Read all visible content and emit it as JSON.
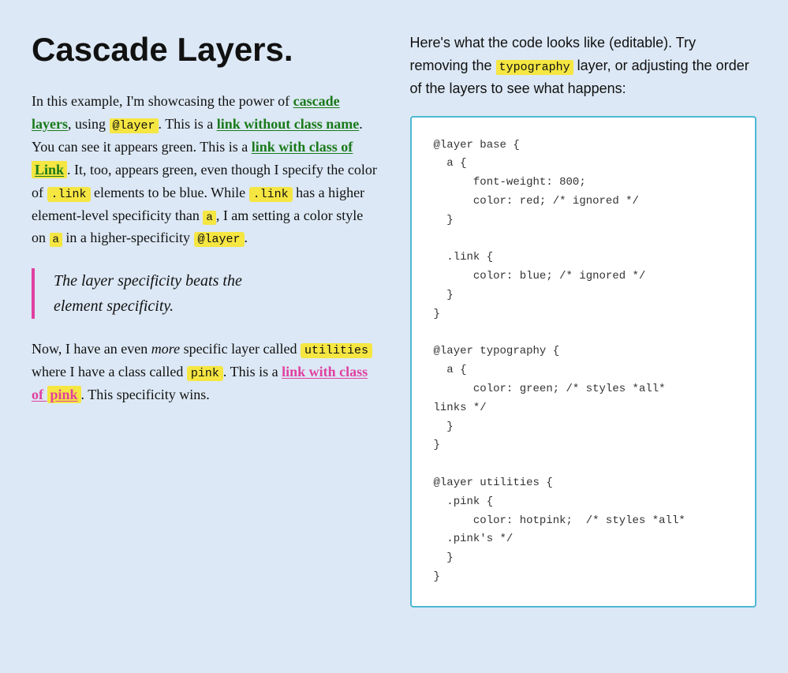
{
  "page": {
    "title": "Cascade Layers.",
    "left": {
      "intro": "In this example, I'm showcasing the power of",
      "cascade_layers_link": "cascade layers",
      "using_text": ", using",
      "at_layer_code": "@layer",
      "period_text": ". This is a",
      "link_without_class": "link without class name",
      "can_see_text": ". You can see it appears green. This is a",
      "link_with_class_of": "link with class of",
      "link_code": "link",
      "period2": ". It, too, appears green, even though I specify the color of",
      "dot_link_code": ".link",
      "elements_text": "elements to be blue. While",
      "dot_link_code2": ".link",
      "has_a_text": "has a higher element-level specificity than",
      "a_code": "a",
      "setting_text": ", I am setting a color style on",
      "a_code2": "a",
      "in_higher_text": "in a higher-specificity",
      "at_layer_code2": "@layer",
      "final_period": ".",
      "blockquote": {
        "line1": "The ",
        "layer_em": "layer",
        "line1_rest": " specificity beats the",
        "line2_em": "element specificity",
        "line2_rest": "."
      },
      "now_text": "Now, I have an even",
      "more_em": "more",
      "specific_text": "specific layer called",
      "utilities_code": "utilities",
      "where_text": "where I have a class called",
      "pink_code": "pink",
      "this_is_text": ". This is a",
      "link_with_class_of2": "link with class of",
      "pink_code2": "pink",
      "this_specificity": ". This specificity wins."
    },
    "right": {
      "intro_line1": "Here's what the code looks like (editable). Try",
      "intro_line2": "removing the",
      "typography_code": "typography",
      "intro_line2_rest": "layer, or adjusting",
      "intro_line3": "the order of the layers to see what happens:",
      "code": "@layer base {\n  a {\n      font-weight: 800;\n      color: red; /* ignored */\n  }\n\n  .link {\n      color: blue; /* ignored */\n  }\n}\n\n@layer typography {\n  a {\n      color: green; /* styles *all*\nlinks */\n  }\n}\n\n@layer utilities {\n  .pink {\n      color: hotpink;  /* styles *all*\n  .pink's */\n  }\n}"
    }
  }
}
